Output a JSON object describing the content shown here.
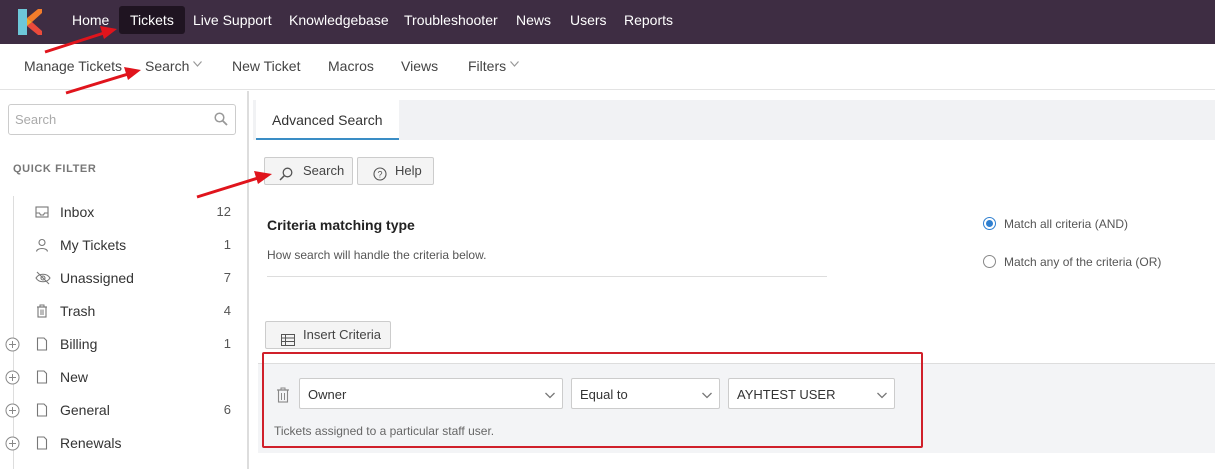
{
  "topnav": {
    "logo_icon": "kayako-logo-icon",
    "items": [
      {
        "label": "Home",
        "active": false
      },
      {
        "label": "Tickets",
        "active": true
      },
      {
        "label": "Live Support",
        "active": false
      },
      {
        "label": "Knowledgebase",
        "active": false
      },
      {
        "label": "Troubleshooter",
        "active": false
      },
      {
        "label": "News",
        "active": false
      },
      {
        "label": "Users",
        "active": false
      },
      {
        "label": "Reports",
        "active": false
      }
    ]
  },
  "subnav": {
    "items": [
      {
        "label": "Manage Tickets",
        "dropdown": false
      },
      {
        "label": "Search",
        "dropdown": true
      },
      {
        "label": "New Ticket",
        "dropdown": false
      },
      {
        "label": "Macros",
        "dropdown": false
      },
      {
        "label": "Views",
        "dropdown": false
      },
      {
        "label": "Filters",
        "dropdown": true
      }
    ]
  },
  "sidebar": {
    "search_placeholder": "Search",
    "quick_filter_label": "QUICK FILTER",
    "items": [
      {
        "label": "Inbox",
        "count": "12",
        "icon": "inbox-icon"
      },
      {
        "label": "My Tickets",
        "count": "1",
        "icon": "user-icon"
      },
      {
        "label": "Unassigned",
        "count": "7",
        "icon": "eye-slash-icon"
      },
      {
        "label": "Trash",
        "count": "4",
        "icon": "trash-icon"
      },
      {
        "label": "Billing",
        "count": "1",
        "icon": "document-icon",
        "expandable": true
      },
      {
        "label": "New",
        "count": "",
        "icon": "document-icon",
        "expandable": true
      },
      {
        "label": "General",
        "count": "6",
        "icon": "document-icon",
        "expandable": true
      },
      {
        "label": "Renewals",
        "count": "",
        "icon": "document-icon",
        "expandable": true
      }
    ]
  },
  "main": {
    "tab_label": "Advanced Search",
    "search_button": "Search",
    "help_button": "Help",
    "criteria_title": "Criteria matching type",
    "criteria_desc": "How search will handle the criteria below.",
    "match_all_label": "Match all criteria (AND)",
    "match_any_label": "Match any of the criteria (OR)",
    "match_selected": "all",
    "insert_criteria_button": "Insert Criteria",
    "criteria_row": {
      "field": "Owner",
      "operator": "Equal to",
      "value": "AYHTEST USER",
      "help_text": "Tickets assigned to a particular staff user."
    }
  },
  "colors": {
    "topbar": "#3e2d43",
    "active_tab": "#1f1421",
    "accent": "#3a8dc5",
    "annotation_red": "#d0202a"
  }
}
